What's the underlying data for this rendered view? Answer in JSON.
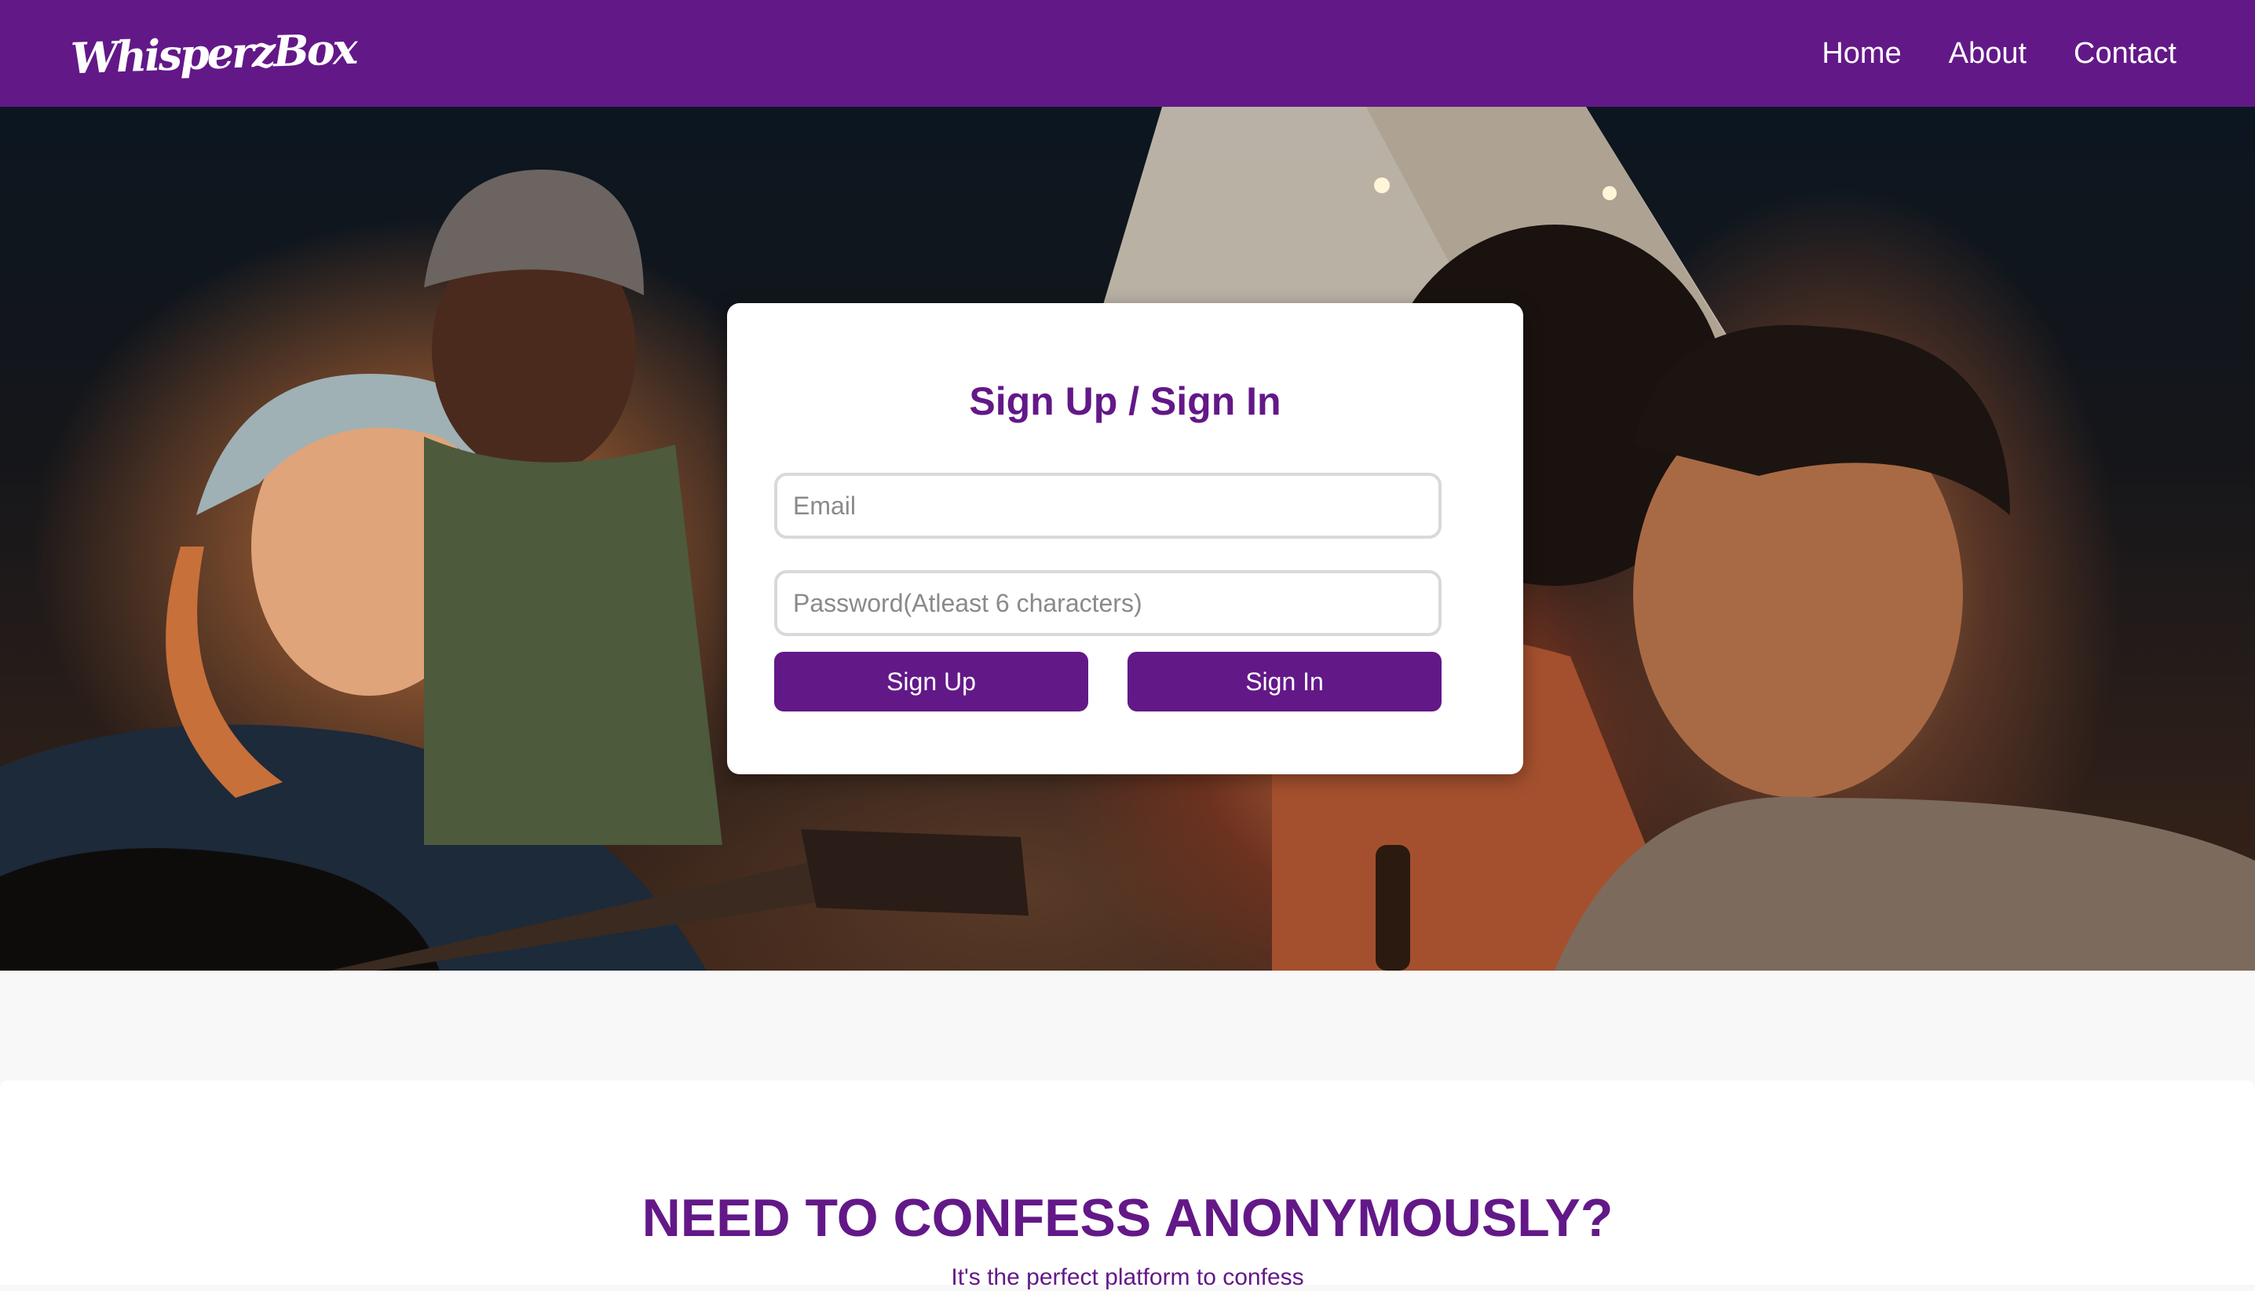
{
  "brand": {
    "logo_text": "WhisperzBox",
    "primary_color": "#631888"
  },
  "nav": {
    "links": [
      "Home",
      "About",
      "Contact"
    ]
  },
  "hero": {
    "image_description": "hero-photo-people-around-campfire"
  },
  "login": {
    "title": "Sign Up / Sign In",
    "email_placeholder": "Email",
    "password_placeholder": "Password(Atleast 6 characters)",
    "signup_label": "Sign Up",
    "signin_label": "Sign In"
  },
  "promo": {
    "heading": "NEED TO CONFESS ANONYMOUSLY?",
    "subtext": "It's the perfect platform to confess"
  }
}
